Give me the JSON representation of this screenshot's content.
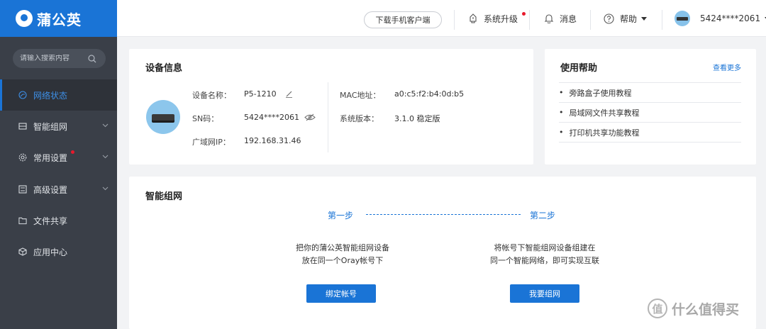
{
  "brand": {
    "name": "蒲公英"
  },
  "topbar": {
    "download_label": "下载手机客户端",
    "upgrade_label": "系统升级",
    "messages_label": "消息",
    "help_label": "帮助",
    "user_label": "5424****2061"
  },
  "sidebar": {
    "search_placeholder": "请输入搜索内容",
    "items": [
      {
        "label": "网络状态",
        "icon": "network-icon",
        "active": true
      },
      {
        "label": "智能组网",
        "icon": "mesh-icon"
      },
      {
        "label": "常用设置",
        "icon": "gear-icon"
      },
      {
        "label": "高级设置",
        "icon": "advanced-settings-icon"
      },
      {
        "label": "文件共享",
        "icon": "folder-share-icon"
      },
      {
        "label": "应用中心",
        "icon": "app-center-icon"
      }
    ]
  },
  "device": {
    "title": "设备信息",
    "name_label": "设备名称：",
    "name_value": "P5-1210",
    "sn_label": "SN码：",
    "sn_value": "5424****2061",
    "ip_label": "广域网IP：",
    "ip_value": "192.168.31.46",
    "mac_label": "MAC地址：",
    "mac_value": "a0:c5:f2:b4:0d:b5",
    "version_label": "系统版本：",
    "version_value": "3.1.0 稳定版"
  },
  "help": {
    "title": "使用帮助",
    "more_label": "查看更多",
    "items": [
      "旁路盒子使用教程",
      "局域网文件共享教程",
      "打印机共享功能教程"
    ]
  },
  "mesh": {
    "title": "智能组网",
    "step1_label": "第一步",
    "step2_label": "第二步",
    "step1_line1": "把你的蒲公英智能组网设备",
    "step1_line2": "放在同一个Oray帐号下",
    "step2_line1": "将帐号下智能组网设备组建在",
    "step2_line2": "同一个智能网络，即可实现互联",
    "bind_button": "绑定帐号",
    "network_button": "我要组网"
  },
  "watermark": {
    "text": "什么值得买",
    "mark": "值"
  },
  "colors": {
    "primary": "#1a74d6",
    "sidebar": "#3a3f48",
    "alert": "#e8192c"
  }
}
